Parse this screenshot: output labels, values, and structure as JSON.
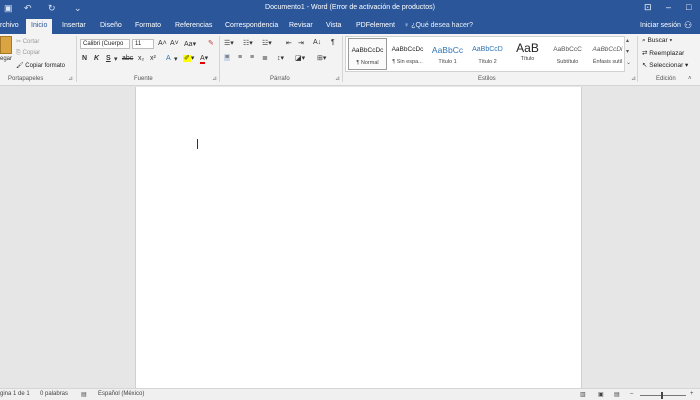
{
  "window": {
    "title": "Documento1 - Word (Error de activación de productos)",
    "save_icon": "save-icon",
    "undo_icon": "undo-icon",
    "redo_icon": "redo-icon",
    "customize_icon": "customize-qat-icon",
    "ribbon_options_icon": "ribbon-display-options-icon",
    "minimize_icon": "minimize-icon",
    "maximize_icon": "maximize-icon"
  },
  "tabs": [
    "rchivo",
    "Inicio",
    "Insertar",
    "Diseño",
    "Formato",
    "Referencias",
    "Correspondencia",
    "Revisar",
    "Vista",
    "PDFelement"
  ],
  "active_tab": "Inicio",
  "tell_me": "¿Qué desea hacer?",
  "sign_in": "Iniciar sesión",
  "clipboard": {
    "paste": "egar",
    "cut": "Cortar",
    "copy": "Copiar",
    "format_painter": "Copiar formato",
    "label": "Portapapeles"
  },
  "font": {
    "name": "Calibri (Cuerpo",
    "size": "11",
    "grow": "A",
    "shrink": "A",
    "case": "Aa",
    "bold": "N",
    "italic": "K",
    "underline": "S",
    "strike": "abc",
    "subscript": "x₂",
    "superscript": "x²",
    "text_effects": "A",
    "font_color": "A",
    "label": "Fuente"
  },
  "paragraph": {
    "label": "Párrafo",
    "sort": "A↓",
    "pilcrow": "¶"
  },
  "styles": {
    "label": "Estilos",
    "items": [
      {
        "sample": "AaBbCcDc",
        "name": "¶ Normal",
        "color": "#222222"
      },
      {
        "sample": "AaBbCcDc",
        "name": "¶ Sin espa...",
        "color": "#222222"
      },
      {
        "sample": "AaBbCc",
        "name": "Título 1",
        "color": "#2e74b5"
      },
      {
        "sample": "AaBbCcD",
        "name": "Título 2",
        "color": "#2e74b5"
      },
      {
        "sample": "AaB",
        "name": "Título",
        "color": "#222222"
      },
      {
        "sample": "AaBbCcC",
        "name": "Subtítulo",
        "color": "#555555"
      },
      {
        "sample": "AaBbCcDi",
        "name": "Énfasis sutil",
        "color": "#555555"
      }
    ]
  },
  "editing": {
    "label": "Edición",
    "find": "Buscar",
    "replace": "Reemplazar",
    "select": "Seleccionar"
  },
  "status": {
    "page": "gina 1 de 1",
    "words": "0 palabras",
    "language": "Español (México)"
  },
  "colors": {
    "accent": "#2b579a",
    "ribbon": "#f3f3f3",
    "canvas": "#e6e6e6",
    "highlight": "#ffff00",
    "font_color_bar": "#e00000"
  }
}
